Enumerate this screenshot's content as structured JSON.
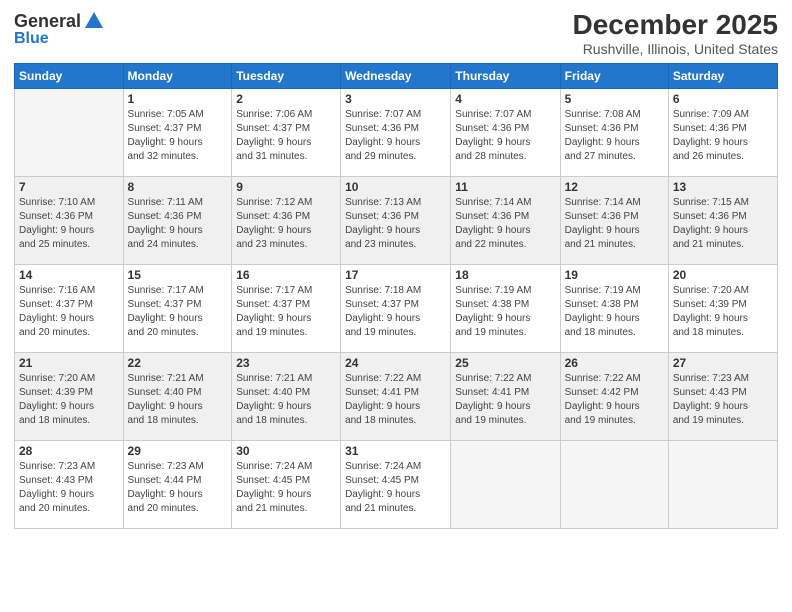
{
  "logo": {
    "general": "General",
    "blue": "Blue"
  },
  "header": {
    "month": "December 2025",
    "location": "Rushville, Illinois, United States"
  },
  "days_of_week": [
    "Sunday",
    "Monday",
    "Tuesday",
    "Wednesday",
    "Thursday",
    "Friday",
    "Saturday"
  ],
  "weeks": [
    [
      {
        "day": "",
        "info": ""
      },
      {
        "day": "1",
        "info": "Sunrise: 7:05 AM\nSunset: 4:37 PM\nDaylight: 9 hours\nand 32 minutes."
      },
      {
        "day": "2",
        "info": "Sunrise: 7:06 AM\nSunset: 4:37 PM\nDaylight: 9 hours\nand 31 minutes."
      },
      {
        "day": "3",
        "info": "Sunrise: 7:07 AM\nSunset: 4:36 PM\nDaylight: 9 hours\nand 29 minutes."
      },
      {
        "day": "4",
        "info": "Sunrise: 7:07 AM\nSunset: 4:36 PM\nDaylight: 9 hours\nand 28 minutes."
      },
      {
        "day": "5",
        "info": "Sunrise: 7:08 AM\nSunset: 4:36 PM\nDaylight: 9 hours\nand 27 minutes."
      },
      {
        "day": "6",
        "info": "Sunrise: 7:09 AM\nSunset: 4:36 PM\nDaylight: 9 hours\nand 26 minutes."
      }
    ],
    [
      {
        "day": "7",
        "info": "Sunrise: 7:10 AM\nSunset: 4:36 PM\nDaylight: 9 hours\nand 25 minutes."
      },
      {
        "day": "8",
        "info": "Sunrise: 7:11 AM\nSunset: 4:36 PM\nDaylight: 9 hours\nand 24 minutes."
      },
      {
        "day": "9",
        "info": "Sunrise: 7:12 AM\nSunset: 4:36 PM\nDaylight: 9 hours\nand 23 minutes."
      },
      {
        "day": "10",
        "info": "Sunrise: 7:13 AM\nSunset: 4:36 PM\nDaylight: 9 hours\nand 23 minutes."
      },
      {
        "day": "11",
        "info": "Sunrise: 7:14 AM\nSunset: 4:36 PM\nDaylight: 9 hours\nand 22 minutes."
      },
      {
        "day": "12",
        "info": "Sunrise: 7:14 AM\nSunset: 4:36 PM\nDaylight: 9 hours\nand 21 minutes."
      },
      {
        "day": "13",
        "info": "Sunrise: 7:15 AM\nSunset: 4:36 PM\nDaylight: 9 hours\nand 21 minutes."
      }
    ],
    [
      {
        "day": "14",
        "info": "Sunrise: 7:16 AM\nSunset: 4:37 PM\nDaylight: 9 hours\nand 20 minutes."
      },
      {
        "day": "15",
        "info": "Sunrise: 7:17 AM\nSunset: 4:37 PM\nDaylight: 9 hours\nand 20 minutes."
      },
      {
        "day": "16",
        "info": "Sunrise: 7:17 AM\nSunset: 4:37 PM\nDaylight: 9 hours\nand 19 minutes."
      },
      {
        "day": "17",
        "info": "Sunrise: 7:18 AM\nSunset: 4:37 PM\nDaylight: 9 hours\nand 19 minutes."
      },
      {
        "day": "18",
        "info": "Sunrise: 7:19 AM\nSunset: 4:38 PM\nDaylight: 9 hours\nand 19 minutes."
      },
      {
        "day": "19",
        "info": "Sunrise: 7:19 AM\nSunset: 4:38 PM\nDaylight: 9 hours\nand 18 minutes."
      },
      {
        "day": "20",
        "info": "Sunrise: 7:20 AM\nSunset: 4:39 PM\nDaylight: 9 hours\nand 18 minutes."
      }
    ],
    [
      {
        "day": "21",
        "info": "Sunrise: 7:20 AM\nSunset: 4:39 PM\nDaylight: 9 hours\nand 18 minutes."
      },
      {
        "day": "22",
        "info": "Sunrise: 7:21 AM\nSunset: 4:40 PM\nDaylight: 9 hours\nand 18 minutes."
      },
      {
        "day": "23",
        "info": "Sunrise: 7:21 AM\nSunset: 4:40 PM\nDaylight: 9 hours\nand 18 minutes."
      },
      {
        "day": "24",
        "info": "Sunrise: 7:22 AM\nSunset: 4:41 PM\nDaylight: 9 hours\nand 18 minutes."
      },
      {
        "day": "25",
        "info": "Sunrise: 7:22 AM\nSunset: 4:41 PM\nDaylight: 9 hours\nand 19 minutes."
      },
      {
        "day": "26",
        "info": "Sunrise: 7:22 AM\nSunset: 4:42 PM\nDaylight: 9 hours\nand 19 minutes."
      },
      {
        "day": "27",
        "info": "Sunrise: 7:23 AM\nSunset: 4:43 PM\nDaylight: 9 hours\nand 19 minutes."
      }
    ],
    [
      {
        "day": "28",
        "info": "Sunrise: 7:23 AM\nSunset: 4:43 PM\nDaylight: 9 hours\nand 20 minutes."
      },
      {
        "day": "29",
        "info": "Sunrise: 7:23 AM\nSunset: 4:44 PM\nDaylight: 9 hours\nand 20 minutes."
      },
      {
        "day": "30",
        "info": "Sunrise: 7:24 AM\nSunset: 4:45 PM\nDaylight: 9 hours\nand 21 minutes."
      },
      {
        "day": "31",
        "info": "Sunrise: 7:24 AM\nSunset: 4:45 PM\nDaylight: 9 hours\nand 21 minutes."
      },
      {
        "day": "",
        "info": ""
      },
      {
        "day": "",
        "info": ""
      },
      {
        "day": "",
        "info": ""
      }
    ]
  ]
}
